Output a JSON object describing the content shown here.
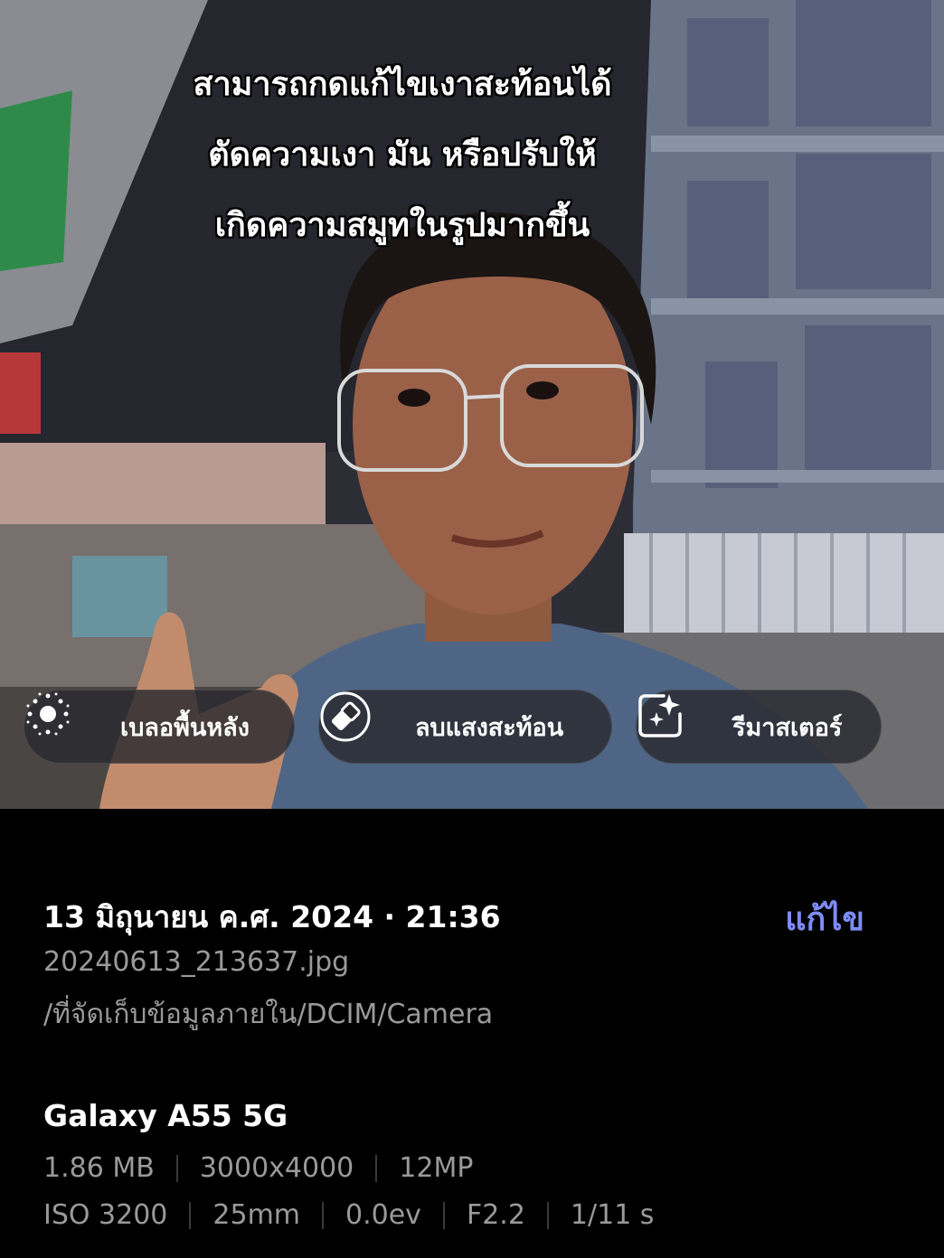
{
  "photo": {
    "caption_lines": [
      "สามารถกดแก้ไขเงาสะท้อนได้",
      "ตัดความเงา มัน หรือปรับให้",
      "เกิดความสมูทในรูปมากขึ้น"
    ],
    "actions": [
      {
        "label": "เบลอพื้นหลัง",
        "icon": "blur-sun-icon"
      },
      {
        "label": "ลบแสงสะท้อน",
        "icon": "eraser-icon"
      },
      {
        "label": "รีมาสเตอร์",
        "icon": "remaster-sparkle-icon"
      }
    ]
  },
  "details": {
    "date": "13 มิถุนายน ค.ศ. 2024 · 21:36",
    "edit_label": "แก้ไข",
    "filename": "20240613_213637.jpg",
    "path": "/ที่จัดเก็บข้อมูลภายใน/DCIM/Camera",
    "device": "Galaxy A55 5G",
    "file_specs": [
      "1.86 MB",
      "3000x4000",
      "12MP"
    ],
    "camera_specs": [
      "ISO 3200",
      "25mm",
      "0.0ev",
      "F2.2",
      "1/11 s"
    ]
  },
  "colors": {
    "accent": "#7e8cf4",
    "background": "#000000",
    "secondary_text": "#9a9a9a"
  }
}
